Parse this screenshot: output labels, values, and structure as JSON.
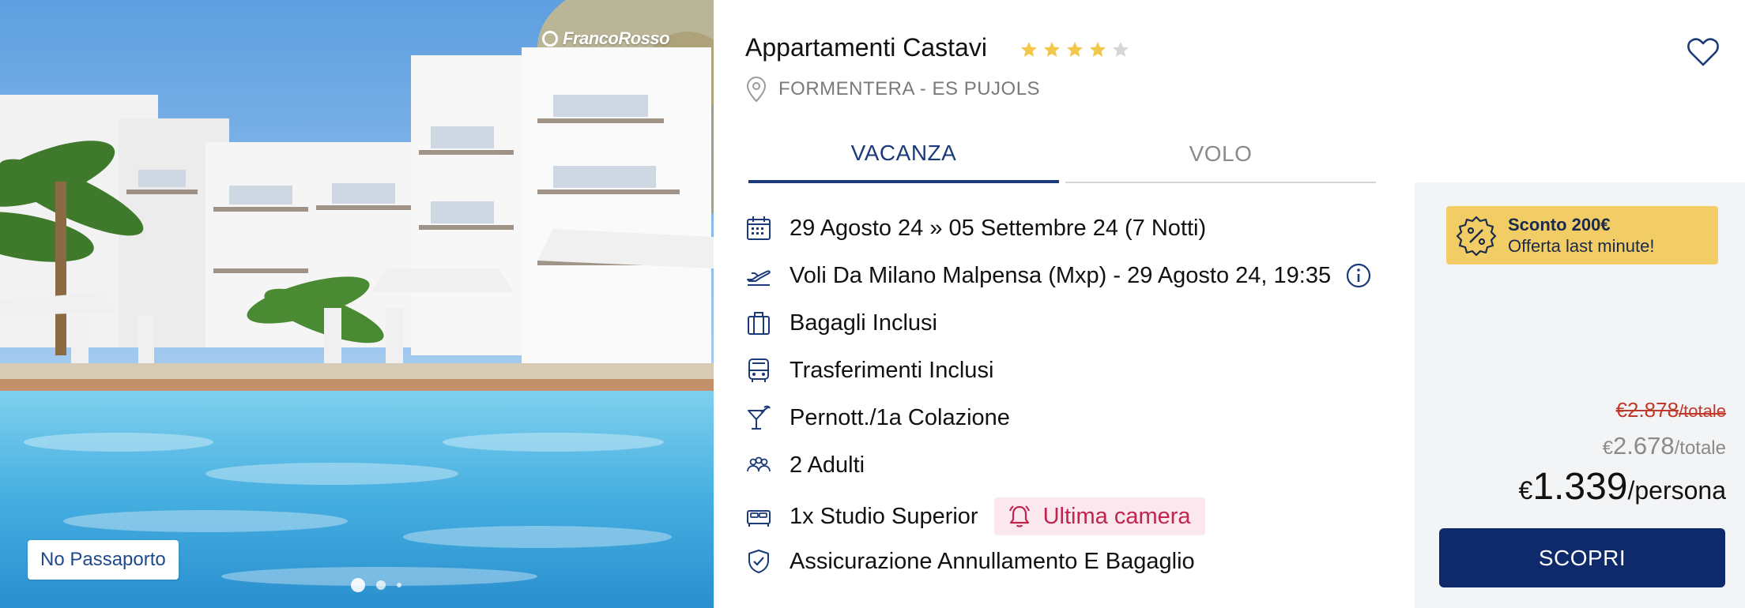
{
  "hotel": {
    "name": "Appartamenti Castavi",
    "stars_filled": 4,
    "stars_total": 5,
    "location": "FORMENTERA - ES PUJOLS"
  },
  "photo": {
    "brand_logo": "FrancoRosso",
    "badge": "No Passaporto",
    "carousel_dots": 3,
    "active_dot": 1
  },
  "tabs": [
    {
      "label": "VACANZA",
      "active": true
    },
    {
      "label": "VOLO",
      "active": false
    }
  ],
  "features": {
    "dates": "29 Agosto 24 » 05 Settembre 24 (7 Notti)",
    "flight": "Voli Da Milano Malpensa (Mxp) - 29 Agosto 24, 19:35",
    "baggage": "Bagagli Inclusi",
    "transfers": "Trasferimenti Inclusi",
    "board": "Pernott./1a Colazione",
    "guests": "2 Adulti",
    "room": "1x Studio Superior",
    "room_urgency": "Ultima camera",
    "insurance": "Assicurazione Annullamento E Bagaglio"
  },
  "price": {
    "discount_title": "Sconto 200€",
    "discount_subtitle": "Offerta last minute!",
    "old_total": "€2.878",
    "old_total_unit": "/totale",
    "total_currency": "€",
    "total": "2.678",
    "total_unit": "/totale",
    "per_person_currency": "€",
    "per_person": "1.339",
    "per_person_unit": "/persona",
    "cta_label": "SCOPRI"
  },
  "colors": {
    "brand_navy": "#0f2a6b",
    "tab_active": "#1b3a7a",
    "star_filled": "#f3c84a",
    "star_empty": "#d6d6d6",
    "discount_bg": "#f2cd66",
    "urgency_bg": "#fbe8ee",
    "urgency_text": "#c0244f",
    "old_price": "#c0392b"
  },
  "icons": {
    "location": "map-pin-icon",
    "favorite": "heart-icon",
    "dates": "calendar-icon",
    "flight": "airplane-takeoff-icon",
    "flight_info": "info-circle-icon",
    "baggage": "suitcase-icon",
    "transfers": "bus-icon",
    "board": "cocktail-icon",
    "guests": "people-icon",
    "room": "bed-icon",
    "urgency": "bell-icon",
    "insurance": "shield-check-icon",
    "discount": "percent-badge-icon"
  }
}
